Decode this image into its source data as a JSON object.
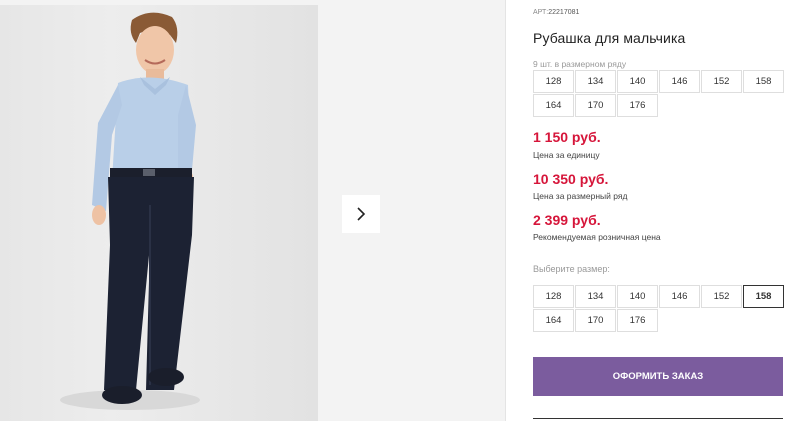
{
  "product": {
    "article_label": "АРТ:",
    "article_value": "22217081",
    "title": "Рубашка для мальчика",
    "in_row_label": "9 шт. в размерном ряду"
  },
  "size_row": [
    "128",
    "134",
    "140",
    "146",
    "152",
    "158",
    "164",
    "170",
    "176"
  ],
  "prices": {
    "unit": {
      "value": "1 150 руб.",
      "label": "Цена за единицу"
    },
    "row": {
      "value": "10 350 руб.",
      "label": "Цена за размерный ряд"
    },
    "retail": {
      "value": "2 399 руб.",
      "label": "Рекомендуемая розничная цена"
    }
  },
  "size_select": {
    "label": "Выберите размер:",
    "options": [
      "128",
      "134",
      "140",
      "146",
      "152",
      "158",
      "164",
      "170",
      "176"
    ],
    "selected": "158"
  },
  "actions": {
    "order_label": "ОФОРМИТЬ ЗАКАЗ"
  },
  "colors": {
    "price": "#d6153a",
    "order_button": "#7b5c9e"
  },
  "icons": {
    "gallery_next": "chevron-right-icon"
  }
}
